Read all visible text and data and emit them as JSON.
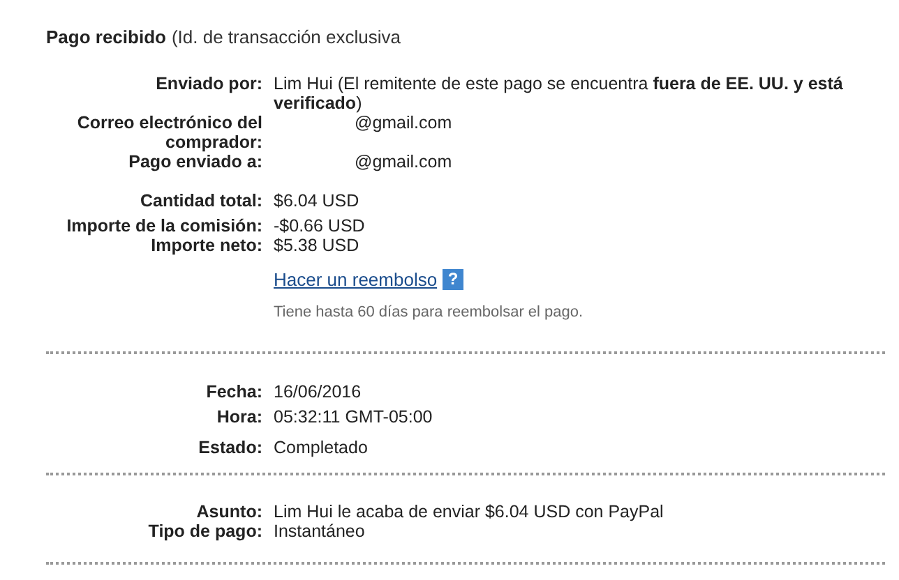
{
  "heading": {
    "title": "Pago recibido",
    "subtitle": "(Id. de transacción exclusiva"
  },
  "sections": [
    {
      "groups": [
        [
          {
            "label": "Enviado por:",
            "value": "Lim Hui (El remitente de este pago se encuentra **fuera de EE. UU. y está verificado**)"
          },
          {
            "label": "Correo electrónico del comprador:",
            "value": "@gmail.com",
            "kind": "redacted"
          },
          {
            "label": "Pago enviado a:",
            "value": "@gmail.com",
            "kind": "redacted"
          }
        ],
        [
          {
            "label": "Cantidad total:",
            "value": "$6.04 USD"
          }
        ],
        [
          {
            "label": "Importe de la comisión:",
            "value": "-$0.66 USD"
          },
          {
            "label": "Importe neto:",
            "value": "$5.38 USD"
          }
        ]
      ],
      "refund": {
        "link": "Hacer un reembolso",
        "help": "?",
        "note": "Tiene hasta 60 días para reembolsar el pago."
      }
    },
    {
      "groups": [
        [
          {
            "label": "Fecha:",
            "value": "16/06/2016"
          }
        ],
        [
          {
            "label": "Hora:",
            "value": "05:32:11 GMT-05:00"
          }
        ],
        [
          {
            "label": "Estado:",
            "value": "Completado"
          }
        ]
      ]
    },
    {
      "groups": [
        [
          {
            "label": "Asunto:",
            "value": "Lim Hui le acaba de enviar $6.04 USD con PayPal"
          },
          {
            "label": "Tipo de pago:",
            "value": "Instantáneo"
          }
        ]
      ]
    }
  ]
}
